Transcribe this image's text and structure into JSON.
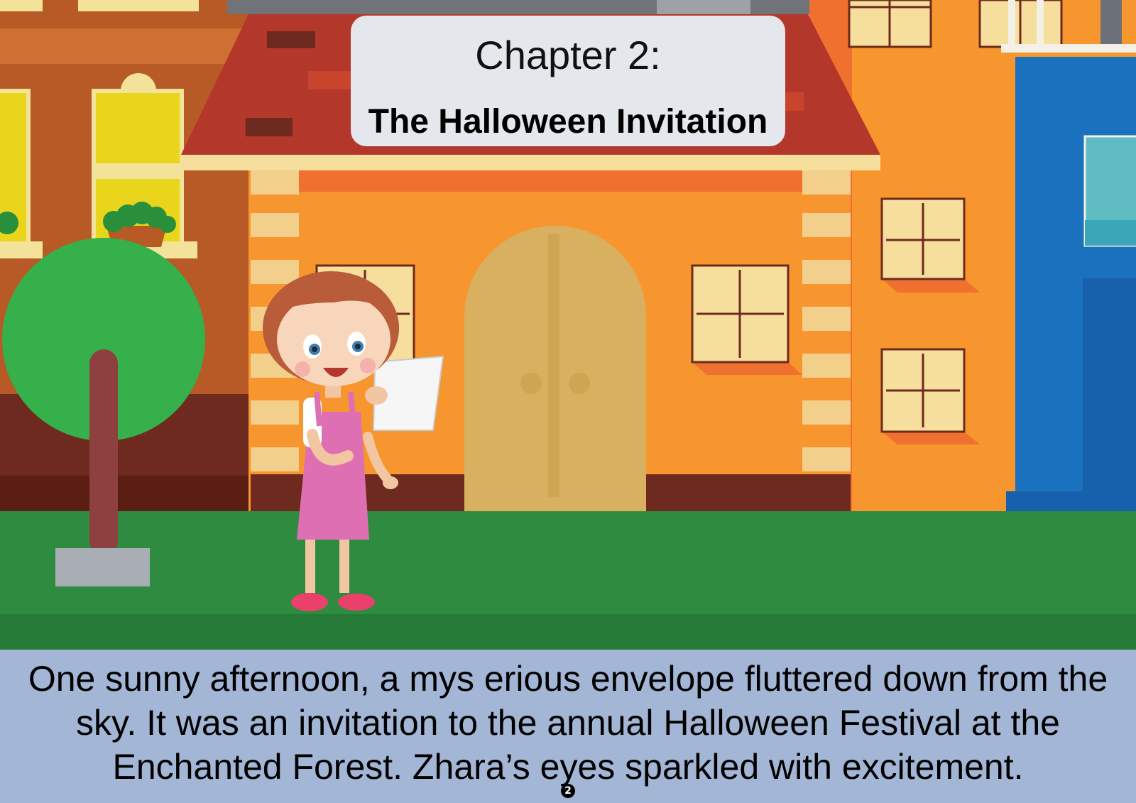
{
  "title": {
    "chapter": "Chapter 2:",
    "name": "The Halloween Invitation"
  },
  "story": {
    "text": "One sunny afternoon, a mys erious envelope fluttered down from the sky. It was an invitation to the annual Halloween Festival at the Enchanted Forest. Zhara’s eyes sparkled with excitement."
  },
  "page_number": "2",
  "illustration": {
    "subjects": [
      "girl-character",
      "invitation-paper",
      "orange-house",
      "green-tree",
      "brown-building",
      "blue-building"
    ]
  },
  "colors": {
    "roof": "#b3372a",
    "house_wall": "#f7962e",
    "door": "#d9b060",
    "grass": "#2f8b40",
    "caption_bg": "#a3b6d6",
    "title_bg": "#e4e7ec"
  }
}
